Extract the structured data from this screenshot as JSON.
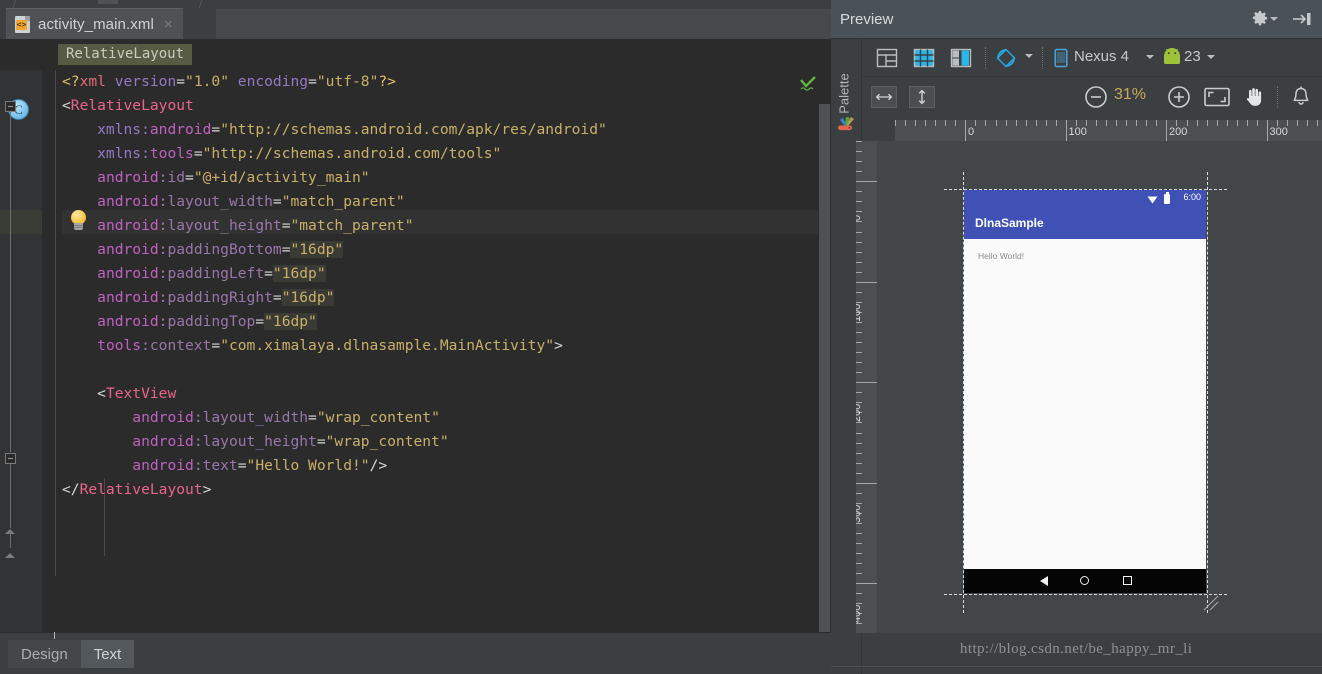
{
  "editor": {
    "tab": {
      "title": "activity_main.xml",
      "close_label": "×",
      "icon": "xml-file-icon",
      "badge": "<>"
    },
    "breadcrumb": "RelativeLayout",
    "gutter": {
      "class_marker": "C",
      "intention_icon": "lightbulb-icon"
    },
    "inspection_status": "ok-check-icon",
    "bottom_tabs": [
      {
        "label": "Design",
        "selected": false
      },
      {
        "label": "Text",
        "selected": true
      }
    ],
    "lines": [
      [
        {
          "t": "<?",
          "c": "t-tag"
        },
        {
          "t": "xml",
          "c": "t-tagname"
        },
        {
          "t": " ",
          "c": "t-plain"
        },
        {
          "t": "version",
          "c": "t-ns"
        },
        {
          "t": "=",
          "c": "t-eq"
        },
        {
          "t": "\"1.0\"",
          "c": "t-val"
        },
        {
          "t": " ",
          "c": "t-plain"
        },
        {
          "t": "encoding",
          "c": "t-ns"
        },
        {
          "t": "=",
          "c": "t-eq"
        },
        {
          "t": "\"utf-8\"",
          "c": "t-val"
        },
        {
          "t": "?>",
          "c": "t-tag"
        }
      ],
      [
        {
          "t": "<",
          "c": "t-eq"
        },
        {
          "t": "RelativeLayout",
          "c": "t-tagname2"
        }
      ],
      [
        {
          "t": "    xmlns:",
          "c": "t-ns"
        },
        {
          "t": "android",
          "c": "t-ns2"
        },
        {
          "t": "=",
          "c": "t-eq"
        },
        {
          "t": "\"http://schemas.android.com/apk/res/android\"",
          "c": "t-val"
        }
      ],
      [
        {
          "t": "    xmlns:",
          "c": "t-ns"
        },
        {
          "t": "tools",
          "c": "t-ns2"
        },
        {
          "t": "=",
          "c": "t-eq"
        },
        {
          "t": "\"http://schemas.android.com/tools\"",
          "c": "t-val"
        }
      ],
      [
        {
          "t": "    ",
          "c": "t-plain"
        },
        {
          "t": "android",
          "c": "t-ns2"
        },
        {
          "t": ":id",
          "c": "t-attr"
        },
        {
          "t": "=",
          "c": "t-eq"
        },
        {
          "t": "\"@+id/activity_main\"",
          "c": "t-val"
        }
      ],
      [
        {
          "t": "    ",
          "c": "t-plain"
        },
        {
          "t": "android",
          "c": "t-ns2"
        },
        {
          "t": ":layout_width",
          "c": "t-attr"
        },
        {
          "t": "=",
          "c": "t-eq"
        },
        {
          "t": "\"match_parent\"",
          "c": "t-val"
        }
      ],
      [
        {
          "t": "    ",
          "c": "t-plain"
        },
        {
          "t": "android",
          "c": "t-ns2"
        },
        {
          "t": ":layout_height",
          "c": "t-attr"
        },
        {
          "t": "=",
          "c": "t-eq"
        },
        {
          "t": "\"match_parent\"",
          "c": "t-val"
        }
      ],
      [
        {
          "t": "    ",
          "c": "t-plain"
        },
        {
          "t": "android",
          "c": "t-ns2"
        },
        {
          "t": ":paddingBottom",
          "c": "t-attr"
        },
        {
          "t": "=",
          "c": "t-eq"
        },
        {
          "t": "\"16dp\"",
          "c": "t-val t-hl"
        }
      ],
      [
        {
          "t": "    ",
          "c": "t-plain"
        },
        {
          "t": "android",
          "c": "t-ns2"
        },
        {
          "t": ":paddingLeft",
          "c": "t-attr"
        },
        {
          "t": "=",
          "c": "t-eq"
        },
        {
          "t": "\"16dp\"",
          "c": "t-val t-hl"
        }
      ],
      [
        {
          "t": "    ",
          "c": "t-plain"
        },
        {
          "t": "android",
          "c": "t-ns2"
        },
        {
          "t": ":paddingRight",
          "c": "t-attr"
        },
        {
          "t": "=",
          "c": "t-eq"
        },
        {
          "t": "\"16dp\"",
          "c": "t-val t-hl"
        }
      ],
      [
        {
          "t": "    ",
          "c": "t-plain"
        },
        {
          "t": "android",
          "c": "t-ns2"
        },
        {
          "t": ":paddingTop",
          "c": "t-attr"
        },
        {
          "t": "=",
          "c": "t-eq"
        },
        {
          "t": "\"16dp\"",
          "c": "t-val t-hl"
        }
      ],
      [
        {
          "t": "    ",
          "c": "t-plain"
        },
        {
          "t": "tools",
          "c": "t-ns2"
        },
        {
          "t": ":context",
          "c": "t-attr"
        },
        {
          "t": "=",
          "c": "t-eq"
        },
        {
          "t": "\"com.ximalaya.dlnasample.MainActivity\"",
          "c": "t-val"
        },
        {
          "t": ">",
          "c": "t-eq"
        }
      ],
      [],
      [
        {
          "t": "    <",
          "c": "t-eq"
        },
        {
          "t": "TextView",
          "c": "t-tagname2"
        }
      ],
      [
        {
          "t": "        ",
          "c": "t-plain"
        },
        {
          "t": "android",
          "c": "t-ns2"
        },
        {
          "t": ":layout_width",
          "c": "t-attr"
        },
        {
          "t": "=",
          "c": "t-eq"
        },
        {
          "t": "\"wrap_content\"",
          "c": "t-val"
        }
      ],
      [
        {
          "t": "        ",
          "c": "t-plain"
        },
        {
          "t": "android",
          "c": "t-ns2"
        },
        {
          "t": ":layout_height",
          "c": "t-attr"
        },
        {
          "t": "=",
          "c": "t-eq"
        },
        {
          "t": "\"wrap_content\"",
          "c": "t-val"
        }
      ],
      [
        {
          "t": "        ",
          "c": "t-plain"
        },
        {
          "t": "android",
          "c": "t-ns2"
        },
        {
          "t": ":text",
          "c": "t-attr"
        },
        {
          "t": "=",
          "c": "t-eq"
        },
        {
          "t": "\"Hello World!\"",
          "c": "t-val"
        },
        {
          "t": "/>",
          "c": "t-eq"
        }
      ],
      [
        {
          "t": "</",
          "c": "t-eq"
        },
        {
          "t": "RelativeLayout",
          "c": "t-tagname2"
        },
        {
          "t": ">",
          "c": "t-eq"
        }
      ]
    ]
  },
  "preview": {
    "title": "Preview",
    "gear_icon": "gear-icon",
    "minimize_icon": "minimize-window-icon",
    "palette_label": "Palette",
    "palette_icon": "palette-icon",
    "toolbar": {
      "buttons": [
        {
          "name": "design-mode-button",
          "icon": "layout-design-icon"
        },
        {
          "name": "blueprint-mode-button",
          "icon": "layout-blueprint-icon"
        },
        {
          "name": "both-mode-button",
          "icon": "layout-both-icon"
        },
        {
          "name": "orientation-button",
          "icon": "rotate-device-icon"
        }
      ],
      "device_label": "Nexus 4",
      "device_icon": "phone-icon",
      "api_label": "23",
      "api_icon": "android-robot-icon",
      "dropdown_icon": "chevron-down-icon"
    },
    "toolbar2": {
      "width_button": "horizontal-resize-icon",
      "height_button": "vertical-resize-icon",
      "zoom_out": "minus-circle-icon",
      "zoom_level": "31%",
      "zoom_in": "plus-circle-icon",
      "zoom_fit": "fit-screen-icon",
      "pan": "hand-pan-icon",
      "notifications": "bell-icon"
    },
    "ruler": {
      "horizontal_labels": [
        "0",
        "100",
        "200",
        "300"
      ],
      "vertical_labels": [
        "0",
        "100",
        "200",
        "300",
        "400"
      ]
    },
    "device": {
      "app_name": "DlnaSample",
      "status_time": "6:00",
      "wifi_icon": "wifi-icon",
      "battery_icon": "battery-icon",
      "content_text": "Hello World!",
      "nav_back": "back-triangle-icon",
      "nav_home": "home-circle-icon",
      "nav_recents": "recents-square-icon",
      "statusbar_color": "#3f51b5"
    },
    "resize_handle": "resize-corner-handle",
    "watermark": "http://blog.csdn.net/be_happy_mr_li"
  }
}
